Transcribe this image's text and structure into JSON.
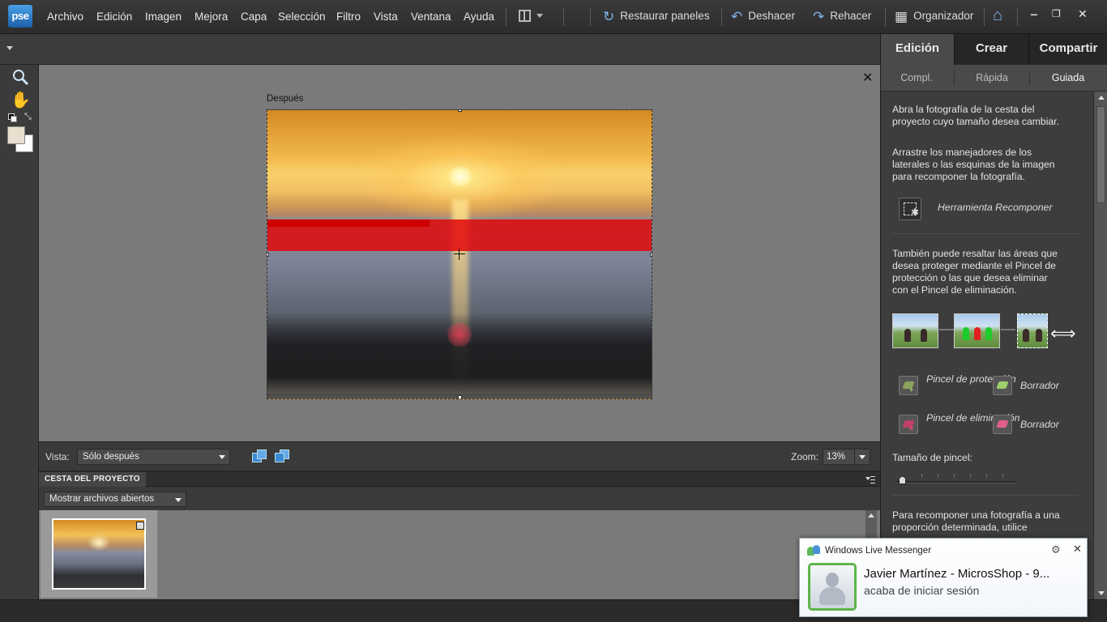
{
  "app": {
    "logo_text": "pse"
  },
  "menu": {
    "items": [
      "Archivo",
      "Edición",
      "Imagen",
      "Mejora",
      "Capa",
      "Selección",
      "Filtro",
      "Vista",
      "Ventana",
      "Ayuda"
    ]
  },
  "toolbar": {
    "restore_panels": "Restaurar paneles",
    "undo": "Deshacer",
    "redo": "Rehacer",
    "organizer": "Organizador"
  },
  "canvas": {
    "after_label": "Después"
  },
  "viewbar": {
    "view_label": "Vista:",
    "view_value": "Sólo después",
    "zoom_label": "Zoom:",
    "zoom_value": "13%"
  },
  "project_bin": {
    "tab": "CESTA DEL PROYECTO",
    "filter_value": "Mostrar archivos abiertos"
  },
  "panel": {
    "tabs": [
      "Edición",
      "Crear",
      "Compartir"
    ],
    "subtabs": [
      "Compl.",
      "Rápida",
      "Guiada"
    ],
    "active_subtab": "Guiada",
    "para1": "Abra la fotografía de la cesta del proyecto cuyo tamaño desea cambiar.",
    "para2": "Arrastre los manejadores de los laterales o las esquinas de la imagen para recomponer la fotografía.",
    "recompose_tool": "Herramienta Recomponer",
    "para3": "También puede resaltar las áreas que desea proteger mediante el Pincel de protección o las que desea eliminar con el Pincel de eliminación.",
    "protect_brush": "Pincel de protección",
    "protect_eraser": "Borrador",
    "remove_brush": "Pincel de eliminación",
    "remove_eraser": "Borrador",
    "brush_size_label": "Tamaño de pincel:",
    "para4": "Para recomponer una fotografía a una proporción determinada, utilice"
  },
  "colors": {
    "protect": "#e20608",
    "accent": "#4aa0e8"
  },
  "messenger": {
    "title": "Windows Live Messenger",
    "contact": "Javier Martínez - MicrosShop - 9...",
    "action": "acaba de iniciar sesión"
  }
}
